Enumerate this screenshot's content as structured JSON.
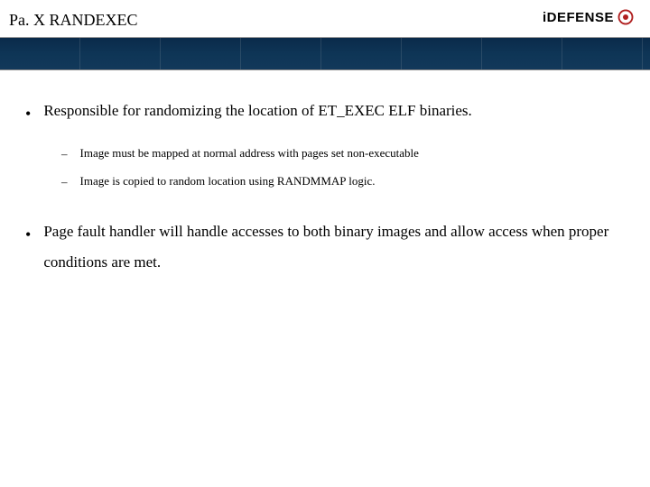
{
  "header": {
    "title": "Pa. X RANDEXEC",
    "logo_text": "iDEFENSE"
  },
  "content": {
    "bullets": [
      {
        "text": "Responsible for randomizing the location of ET_EXEC ELF binaries.",
        "sub": [
          "Image must be mapped at normal address with pages set non-executable",
          "Image is copied to random location using RANDMMAP logic."
        ]
      },
      {
        "text": "Page fault handler will handle accesses to both binary images and allow access when proper conditions are met.",
        "sub": []
      }
    ]
  }
}
